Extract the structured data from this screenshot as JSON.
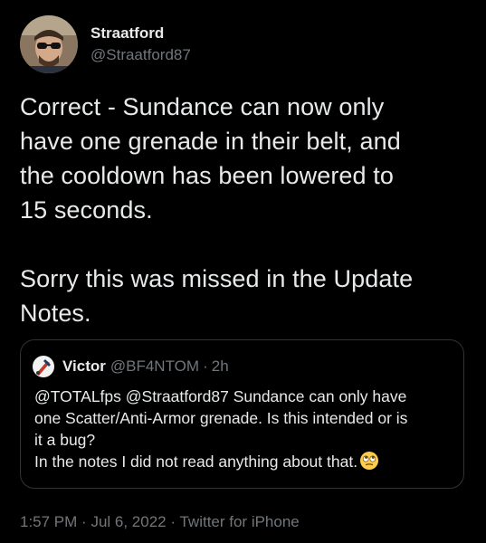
{
  "author": {
    "display_name": "Straatford",
    "handle": "@Straatford87"
  },
  "tweet": {
    "text": "Correct - Sundance can now only\nhave one grenade in their belt, and\nthe cooldown has been lowered to\n15 seconds.\n\nSorry this was missed in the Update\nNotes."
  },
  "quote": {
    "display_name": "Victor",
    "handle": "@BF4NTOM",
    "separator": "·",
    "time": "2h",
    "text": "@TOTALfps @Straatford87 Sundance can only have\none Scatter/Anti-Armor grenade. Is this intended or is\nit a bug?\nIn the notes I did not read anything about that.",
    "emoji": "face-with-rolling-eyes-icon"
  },
  "meta": {
    "time": "1:57 PM",
    "sep1": "·",
    "date": "Jul 6, 2022",
    "sep2": "·",
    "source": "Twitter for iPhone"
  },
  "colors": {
    "background": "#000000",
    "primary_text": "#e7e9ea",
    "secondary_text": "#71767b",
    "border": "#2f3336"
  }
}
